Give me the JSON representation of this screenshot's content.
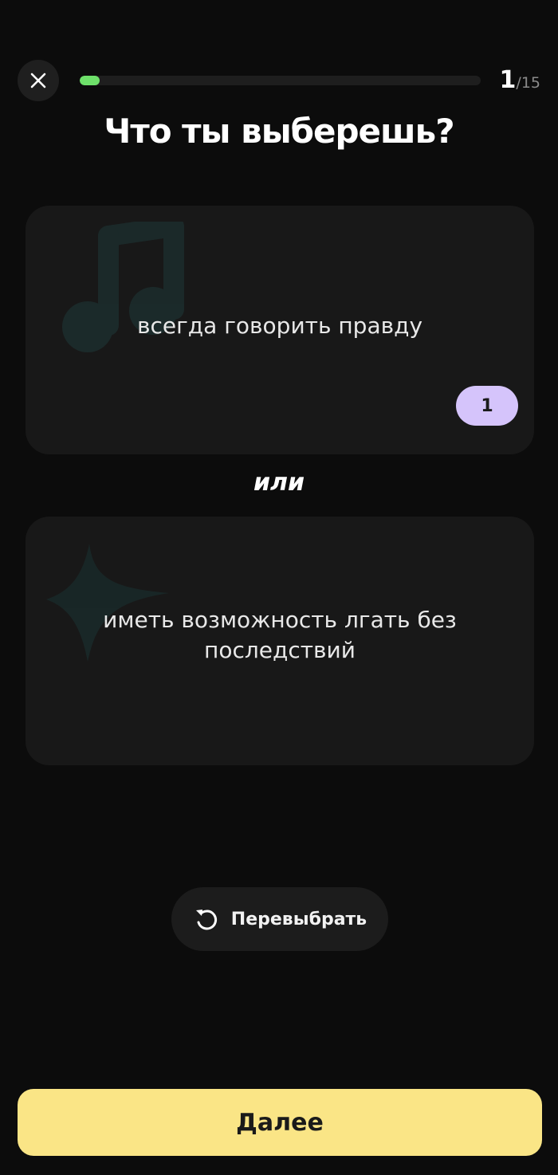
{
  "header": {
    "progress_fraction": 0.05,
    "progress_color": "#6ee06a",
    "counter_current": "1",
    "counter_total": "/15",
    "close_icon": "close-icon"
  },
  "question": {
    "title": "Что ты выберешь?"
  },
  "options": [
    {
      "text": "всегда говорить правду",
      "icon": "music-note-icon",
      "badge": "1",
      "badge_color": "#d5c4fb"
    },
    {
      "text": "иметь возможность лгать без последствий",
      "icon": "sparkle-icon"
    }
  ],
  "divider": {
    "label": "или"
  },
  "reroll": {
    "label": "Перевыбрать",
    "icon": "rotate-ccw-icon"
  },
  "footer": {
    "next_label": "Далее",
    "accent_color": "#fae586"
  }
}
